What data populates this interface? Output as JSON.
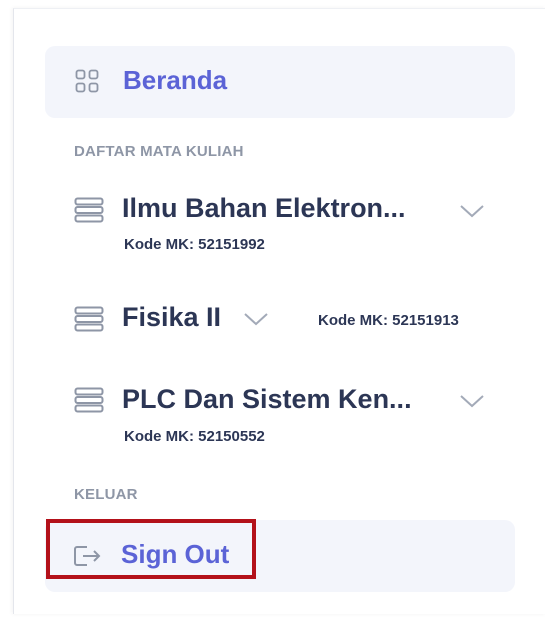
{
  "nav": {
    "home": {
      "label": "Beranda",
      "icon": "grid-icon"
    }
  },
  "courses_section": {
    "heading": "DAFTAR MATA KULIAH",
    "items": [
      {
        "title": "Ilmu Bahan Elektron...",
        "code": "Kode MK: 52151992",
        "icon": "server-stack-icon"
      },
      {
        "title": "Fisika II",
        "code": "Kode MK: 52151913",
        "icon": "server-stack-icon"
      },
      {
        "title": "PLC Dan Sistem Ken...",
        "code": "Kode MK: 52150552",
        "icon": "server-stack-icon"
      }
    ]
  },
  "logout_section": {
    "heading": "KELUAR",
    "signout": {
      "label": "Sign Out",
      "icon": "sign-out-icon"
    }
  },
  "colors": {
    "accent": "#5b63d6",
    "text_dark": "#2c3655",
    "heading_gray": "#8e96a6",
    "item_bg": "#f3f5fb",
    "highlight": "#b3111a"
  }
}
